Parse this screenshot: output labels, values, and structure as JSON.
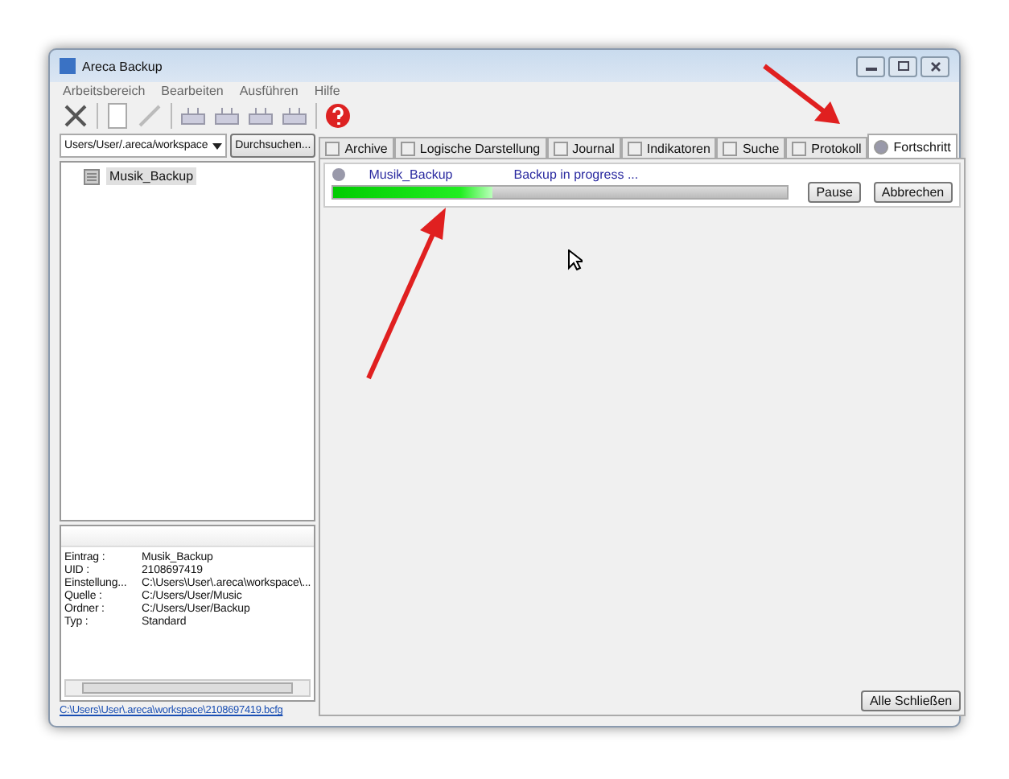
{
  "window": {
    "title": "Areca Backup"
  },
  "menu": [
    "Arbeitsbereich",
    "Bearbeiten",
    "Ausführen",
    "Hilfe"
  ],
  "workspace": {
    "value": "Users/User/.areca/workspace",
    "browse": "Durchsuchen..."
  },
  "tree": [
    {
      "label": "Musik_Backup",
      "selected": true
    }
  ],
  "properties": [
    {
      "key": "Eintrag :",
      "value": "Musik_Backup"
    },
    {
      "key": "UID :",
      "value": "2108697419"
    },
    {
      "key": "Einstellung...",
      "value": "C:\\Users\\User\\.areca\\workspace\\..."
    },
    {
      "key": "Quelle :",
      "value": "C:/Users/User/Music"
    },
    {
      "key": "Ordner :",
      "value": "C:/Users/User/Backup"
    },
    {
      "key": "Typ :",
      "value": "Standard"
    }
  ],
  "status_link": "C:\\Users\\User\\.areca\\workspace\\2108697419.bcfg",
  "tabs": [
    {
      "label": "Archive",
      "selected": false
    },
    {
      "label": "Logische Darstellung",
      "selected": false
    },
    {
      "label": "Journal",
      "selected": false
    },
    {
      "label": "Indikatoren",
      "selected": false
    },
    {
      "label": "Suche",
      "selected": false
    },
    {
      "label": "Protokoll",
      "selected": false
    },
    {
      "label": "Fortschritt",
      "selected": true
    }
  ],
  "task": {
    "name": "Musik_Backup",
    "status": "Backup in progress ...",
    "level": 0.35,
    "buttons": [
      "Pause",
      "Abbrechen"
    ]
  },
  "close_all": "Alle Schließen"
}
